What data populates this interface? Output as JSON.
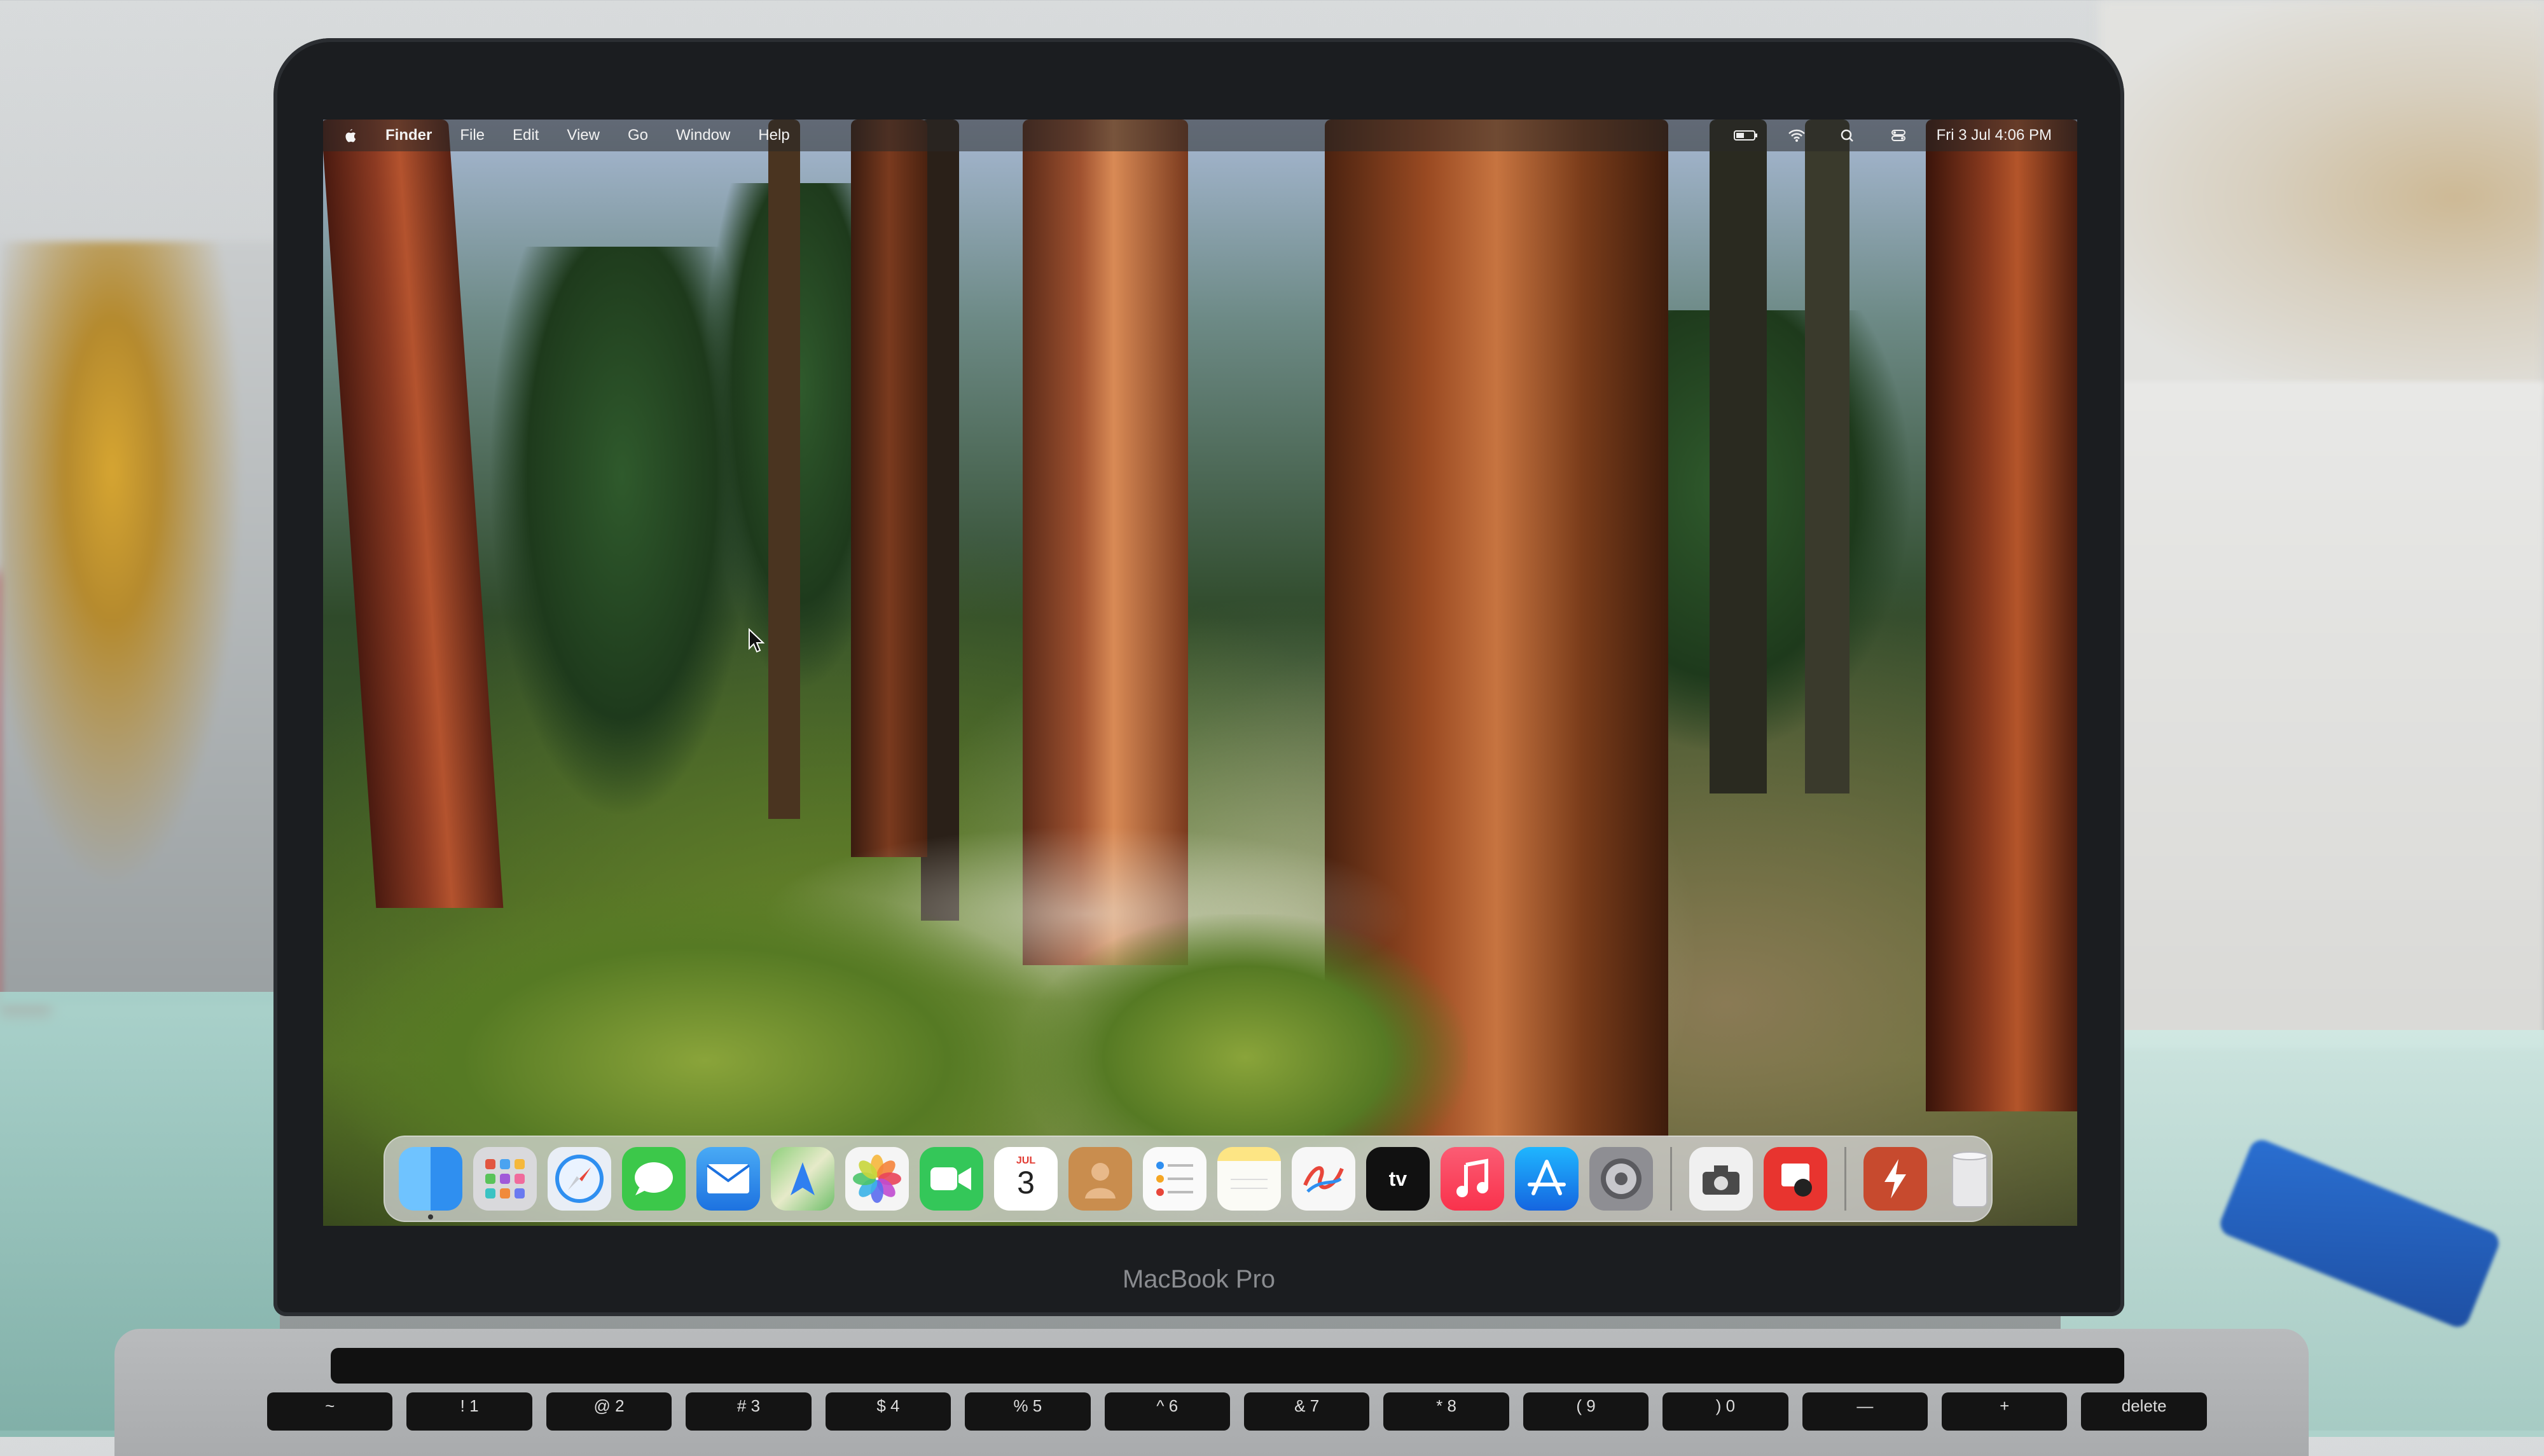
{
  "menubar": {
    "app_name": "Finder",
    "menus": [
      "File",
      "Edit",
      "View",
      "Go",
      "Window",
      "Help"
    ],
    "clock": "Fri 3 Jul  4:06 PM"
  },
  "dock": {
    "apps": [
      {
        "name": "finder-app",
        "bg": "#2f8ff0"
      },
      {
        "name": "launchpad-app",
        "bg": "#d9d9dc"
      },
      {
        "name": "safari-app",
        "bg": "#e9eef6"
      },
      {
        "name": "messages-app",
        "bg": "#3cc84a"
      },
      {
        "name": "mail-app",
        "bg": "#2d8ce8"
      },
      {
        "name": "maps-app",
        "bg": "#6fbf6a"
      },
      {
        "name": "photos-app",
        "bg": "#f5f5f5"
      },
      {
        "name": "facetime-app",
        "bg": "#34c759"
      },
      {
        "name": "calendar-app",
        "bg": "#ffffff"
      },
      {
        "name": "contacts-app",
        "bg": "#c98d4e"
      },
      {
        "name": "reminders-app",
        "bg": "#fafafa"
      },
      {
        "name": "notes-app",
        "bg": "#fde584"
      },
      {
        "name": "freeform-app",
        "bg": "#f7f7f7"
      },
      {
        "name": "tv-app",
        "bg": "#111111"
      },
      {
        "name": "music-app",
        "bg": "#fb3b5a"
      },
      {
        "name": "app-store-app",
        "bg": "#1e88f0"
      },
      {
        "name": "system-settings-app",
        "bg": "#8e8e93"
      }
    ],
    "calendar_month": "JUL",
    "calendar_day": "3",
    "tv_label": "tv"
  },
  "bezel": {
    "model": "MacBook Pro"
  },
  "keyboard": {
    "number_row": [
      "~",
      "!\n1",
      "@\n2",
      "#\n3",
      "$\n4",
      "%\n5",
      "^\n6",
      "&\n7",
      "*\n8",
      "(\n9",
      ")\n0",
      "—",
      "+",
      "delete"
    ]
  }
}
